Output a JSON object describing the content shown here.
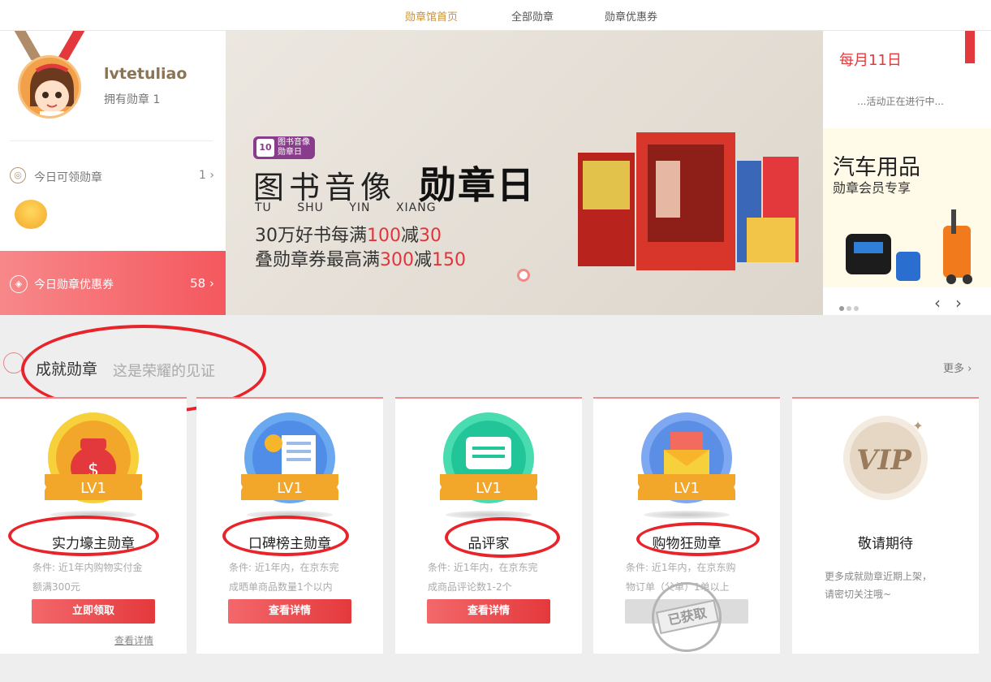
{
  "nav": {
    "items": [
      "勋章馆首页",
      "全部勋章",
      "勋章优惠券"
    ],
    "active_index": 0
  },
  "profile": {
    "username": "lvtetuliao",
    "badge_count": "拥有勋章 1",
    "today_badges_label": "今日可领勋章",
    "today_badges_count": "1",
    "coupon_label": "今日勋章优惠券",
    "coupon_count": "58"
  },
  "banner": {
    "tag_day": "10",
    "tag_text_1": "图书音像",
    "tag_text_2": "勋章日",
    "headline": "图书音像",
    "headline_bold": "勋章日",
    "pinyin": "TU SHU YIN XIANG",
    "line1_a": "30万好书每满",
    "line1_b": "100",
    "line1_c": "减",
    "line1_d": "30",
    "line2_a": "叠勋章券最高满",
    "line2_b": "300",
    "line2_c": "减",
    "line2_d": "150"
  },
  "promo": {
    "date": "每月11日",
    "running": "...活动正在进行中...",
    "ad_title": "汽车用品",
    "ad_subtitle": "勋章会员专享"
  },
  "section": {
    "title": "成就勋章",
    "subtitle": "这是荣耀的见证",
    "more": "更多"
  },
  "cards": [
    {
      "name": "实力壕主勋章",
      "level": "LV1",
      "cond1": "条件: 近1年内购物实付金",
      "cond2": "额满300元",
      "button": "立即领取",
      "detail": "查看详情",
      "color": "#f7b52c"
    },
    {
      "name": "口碑榜主勋章",
      "level": "LV1",
      "cond1": "条件: 近1年内，在京东完",
      "cond2": "成晒单商品数量1个以内",
      "button": "查看详情",
      "color": "#4f8de8"
    },
    {
      "name": "品评家",
      "level": "LV1",
      "cond1": "条件: 近1年内，在京东完",
      "cond2": "成商品评论数1-2个",
      "button": "查看详情",
      "color": "#2ccfa0"
    },
    {
      "name": "购物狂勋章",
      "level": "LV1",
      "cond1": "条件: 近1年内，在京东购",
      "cond2": "物订单（父单）1单以上",
      "button": "已获取",
      "stamp": "已获取",
      "color": "#5b8fe6"
    },
    {
      "name": "敬请期待",
      "vip": "VIP",
      "more1": "更多成就勋章近期上架，",
      "more2": "请密切关注哦~"
    }
  ]
}
